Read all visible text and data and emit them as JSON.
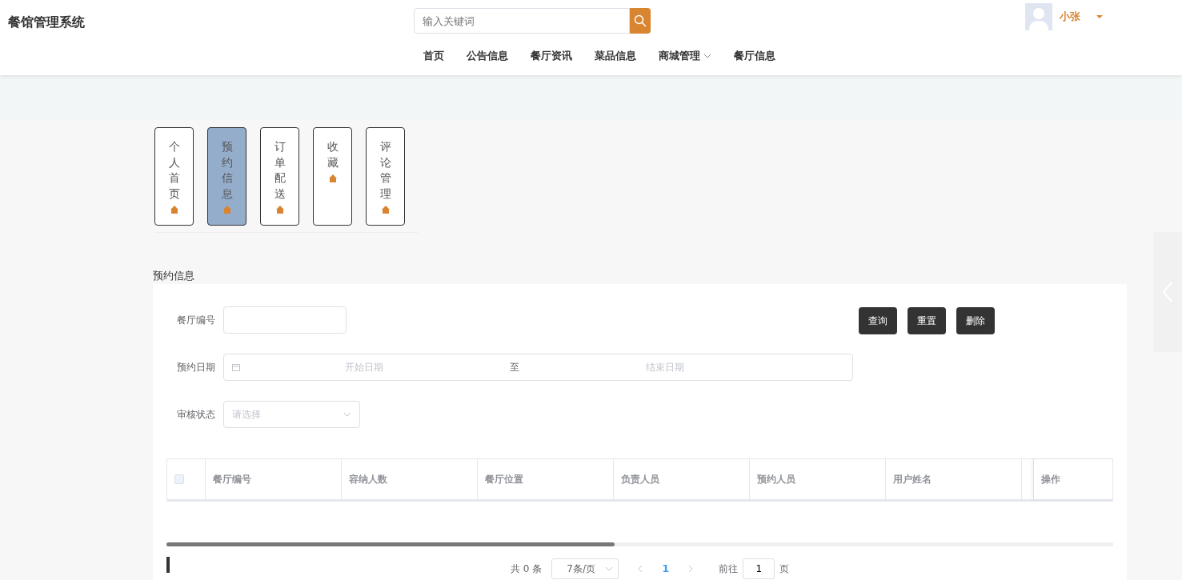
{
  "brand": "餐馆管理系统",
  "search": {
    "placeholder": "输入关键词"
  },
  "nav": [
    {
      "label": "首页",
      "dropdown": false
    },
    {
      "label": "公告信息",
      "dropdown": false
    },
    {
      "label": "餐厅资讯",
      "dropdown": false
    },
    {
      "label": "菜品信息",
      "dropdown": false
    },
    {
      "label": "商城管理",
      "dropdown": true
    },
    {
      "label": "餐厅信息",
      "dropdown": false
    }
  ],
  "user": {
    "name": "小张"
  },
  "side_tabs": [
    {
      "label": "个人首页",
      "selected": false
    },
    {
      "label": "预约信息",
      "selected": true
    },
    {
      "label": "订单配送",
      "selected": false
    },
    {
      "label": "收藏",
      "selected": false
    },
    {
      "label": "评论管理",
      "selected": false
    }
  ],
  "section_title": "预约信息",
  "filters": [
    {
      "kind": "text",
      "label": "餐厅编号"
    },
    {
      "kind": "daterange",
      "label": "预约日期",
      "start_placeholder": "开始日期",
      "separator": "至",
      "end_placeholder": "结束日期"
    },
    {
      "kind": "select",
      "label": "审核状态",
      "placeholder": "请选择"
    }
  ],
  "buttons": [
    "查询",
    "重置",
    "删除"
  ],
  "table": {
    "columns": [
      "餐厅编号",
      "容纳人数",
      "餐厅位置",
      "负责人员",
      "预约人员",
      "用户姓名"
    ],
    "action_column": "操作",
    "checked_all": false
  },
  "pagination": {
    "total": "共 0 条",
    "page_size": "7条/页",
    "pages": [
      {
        "label": "1",
        "selected": true
      }
    ],
    "goto_label": "前往",
    "goto_value": "1",
    "page_suffix": "页"
  }
}
